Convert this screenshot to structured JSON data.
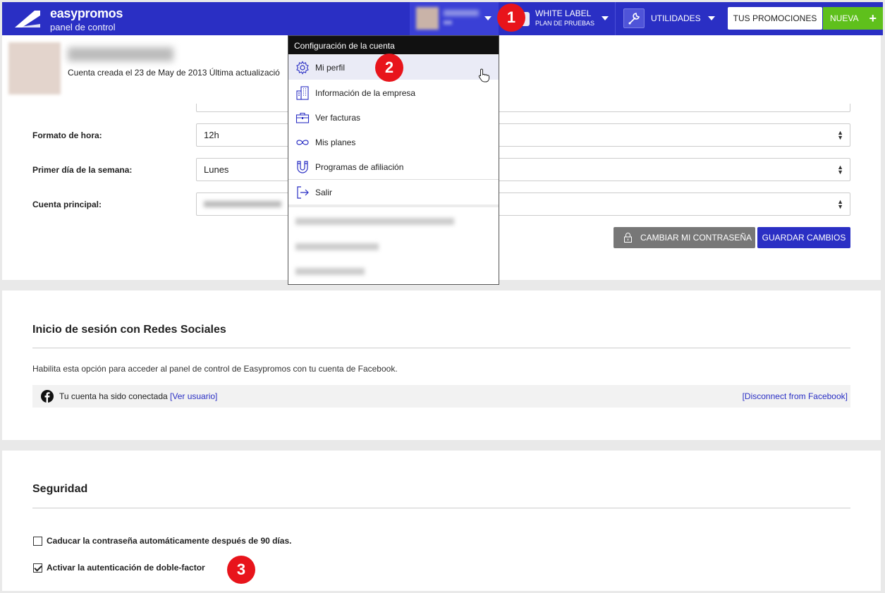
{
  "header": {
    "brand_name": "easypromos",
    "brand_sub": "panel de control",
    "white_label_title": "WHITE LABEL",
    "white_label_sub": "PLAN DE PRUEBAS",
    "utilidades_label": "UTILIDADES",
    "tus_promociones_label": "TUS PROMOCIONES",
    "nueva_label": "NUEVA",
    "nueva_plus": "+"
  },
  "profile": {
    "meta": "Cuenta creada el 23 de May de 2013   Última actualizació"
  },
  "form": {
    "time_format_label": "Formato de hora:",
    "time_format_value": "12h",
    "first_day_label": "Primer día de la semana:",
    "first_day_value": "Lunes",
    "main_account_label": "Cuenta principal:",
    "change_password_label": "CAMBIAR MI CONTRASEÑA",
    "save_label": "GUARDAR CAMBIOS"
  },
  "dropdown": {
    "header": "Configuración de la cuenta",
    "items": [
      {
        "label": "Mi perfil",
        "icon": "gear-icon"
      },
      {
        "label": "Información de la empresa",
        "icon": "building-icon"
      },
      {
        "label": "Ver facturas",
        "icon": "briefcase-icon"
      },
      {
        "label": "Mis planes",
        "icon": "infinity-icon"
      },
      {
        "label": "Programas de afiliación",
        "icon": "magnet-icon"
      },
      {
        "label": "Salir",
        "icon": "logout-icon"
      }
    ]
  },
  "social": {
    "title": "Inicio de sesión con Redes Sociales",
    "description": "Habilita esta opción para acceder al panel de control de Easypromos con tu cuenta de Facebook.",
    "connected_text": "Tu cuenta ha sido conectada",
    "view_user_link": "[Ver usuario]",
    "disconnect_link": "[Disconnect from Facebook]"
  },
  "security": {
    "title": "Seguridad",
    "expire_password_label": "Caducar la contraseña automáticamente después de 90 días.",
    "expire_password_checked": false,
    "two_factor_label": "Activar la autenticación de doble-factor",
    "two_factor_checked": true
  },
  "markers": {
    "m1": "1",
    "m2": "2",
    "m3": "3"
  },
  "colors": {
    "primary": "#2a2fc4",
    "success": "#5fc01c",
    "marker": "#e8141b"
  }
}
